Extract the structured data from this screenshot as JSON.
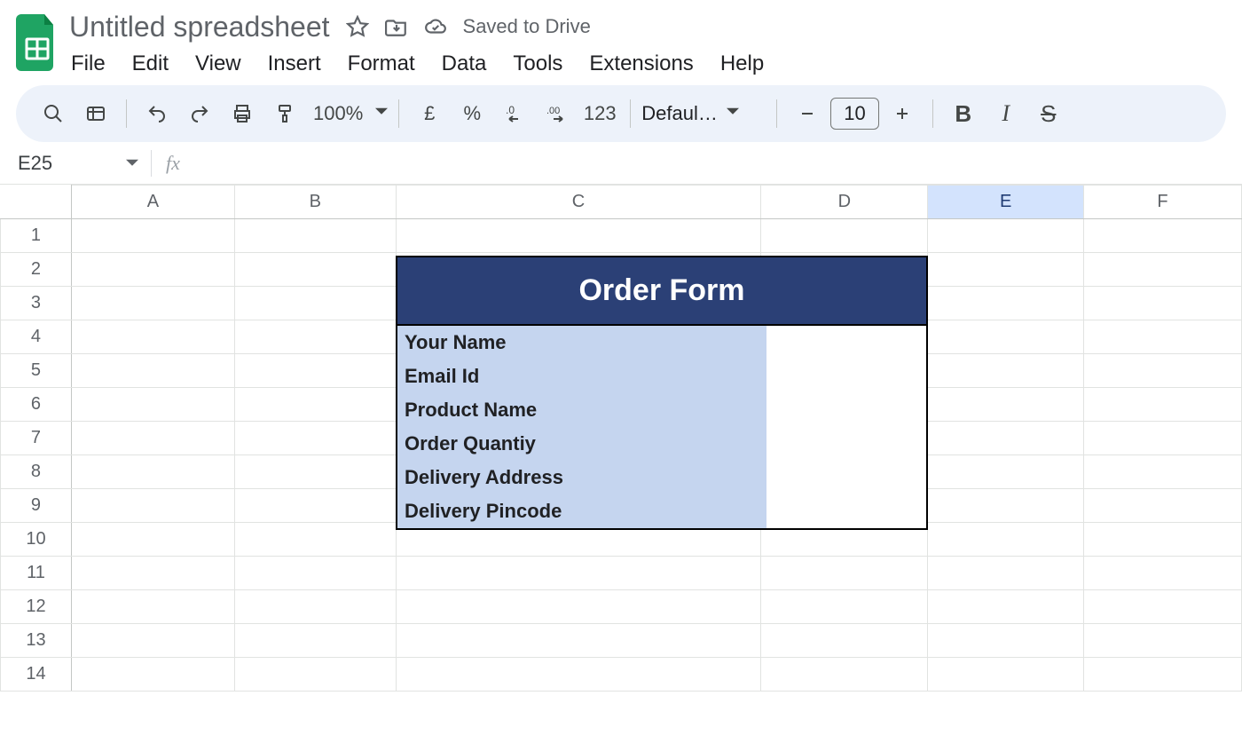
{
  "doc": {
    "title": "Untitled spreadsheet",
    "saved_status": "Saved to Drive"
  },
  "menu": {
    "items": [
      "File",
      "Edit",
      "View",
      "Insert",
      "Format",
      "Data",
      "Tools",
      "Extensions",
      "Help"
    ]
  },
  "toolbar": {
    "zoom": "100%",
    "currency_symbol": "£",
    "percent_symbol": "%",
    "dec_decrease": ".0",
    "dec_increase": ".00",
    "number_format": "123",
    "font_name": "Defaul…",
    "font_size": "10",
    "bold": "B",
    "italic": "I",
    "strike": "S"
  },
  "namebox": {
    "ref": "E25"
  },
  "formula": {
    "fx_label": "fx"
  },
  "grid": {
    "columns": [
      "A",
      "B",
      "C",
      "D",
      "E",
      "F"
    ],
    "selected_column": "E",
    "row_count": 14
  },
  "form": {
    "title": "Order Form",
    "labels": [
      "Your Name",
      "Email Id",
      "Product Name",
      "Order Quantiy",
      "Delivery Address",
      "Delivery Pincode"
    ]
  }
}
